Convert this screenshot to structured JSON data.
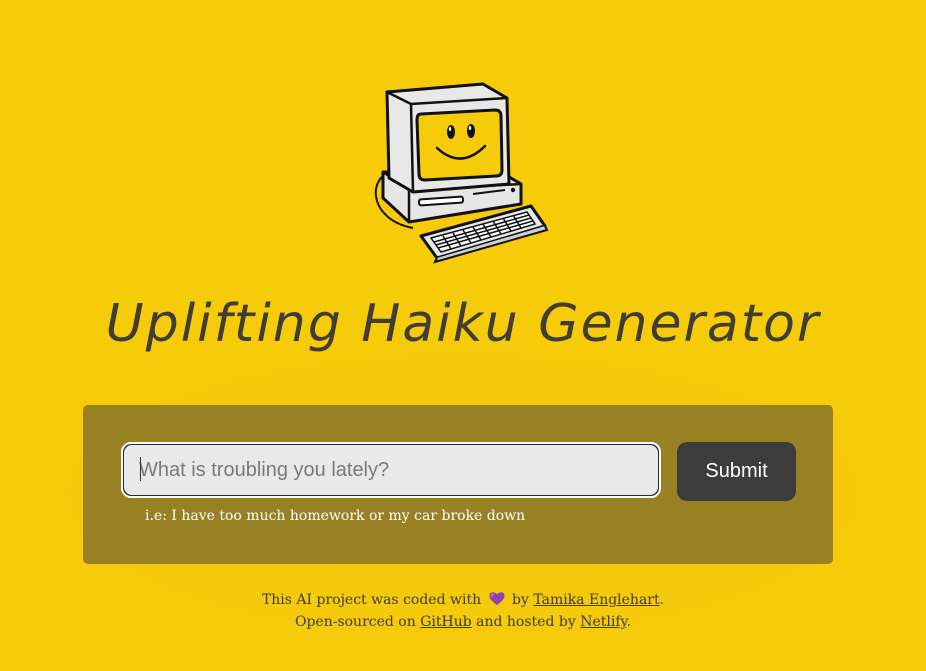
{
  "app": {
    "title": "Uplifting Haiku Generator"
  },
  "logo": {
    "icon": "smiling-computer-icon"
  },
  "form": {
    "input_placeholder": "What is troubling you lately?",
    "input_value": "",
    "submit_label": "Submit",
    "hint": "i.e: I have too much homework or my car broke down"
  },
  "footer": {
    "line1_prefix": "This AI project was coded with",
    "heart_icon": "purple-heart-icon",
    "line1_by": "by",
    "author_name": "Tamika Englehart",
    "line1_suffix": ".",
    "line2_prefix": "Open-sourced on",
    "github_label": "GitHub",
    "line2_middle": "and hosted by",
    "netlify_label": "Netlify",
    "line2_suffix": "."
  },
  "colors": {
    "background": "#f6cb0a",
    "card": "#978123",
    "button": "#3c3c3c",
    "text": "#3f3c30",
    "heart": "#8e44ad"
  }
}
